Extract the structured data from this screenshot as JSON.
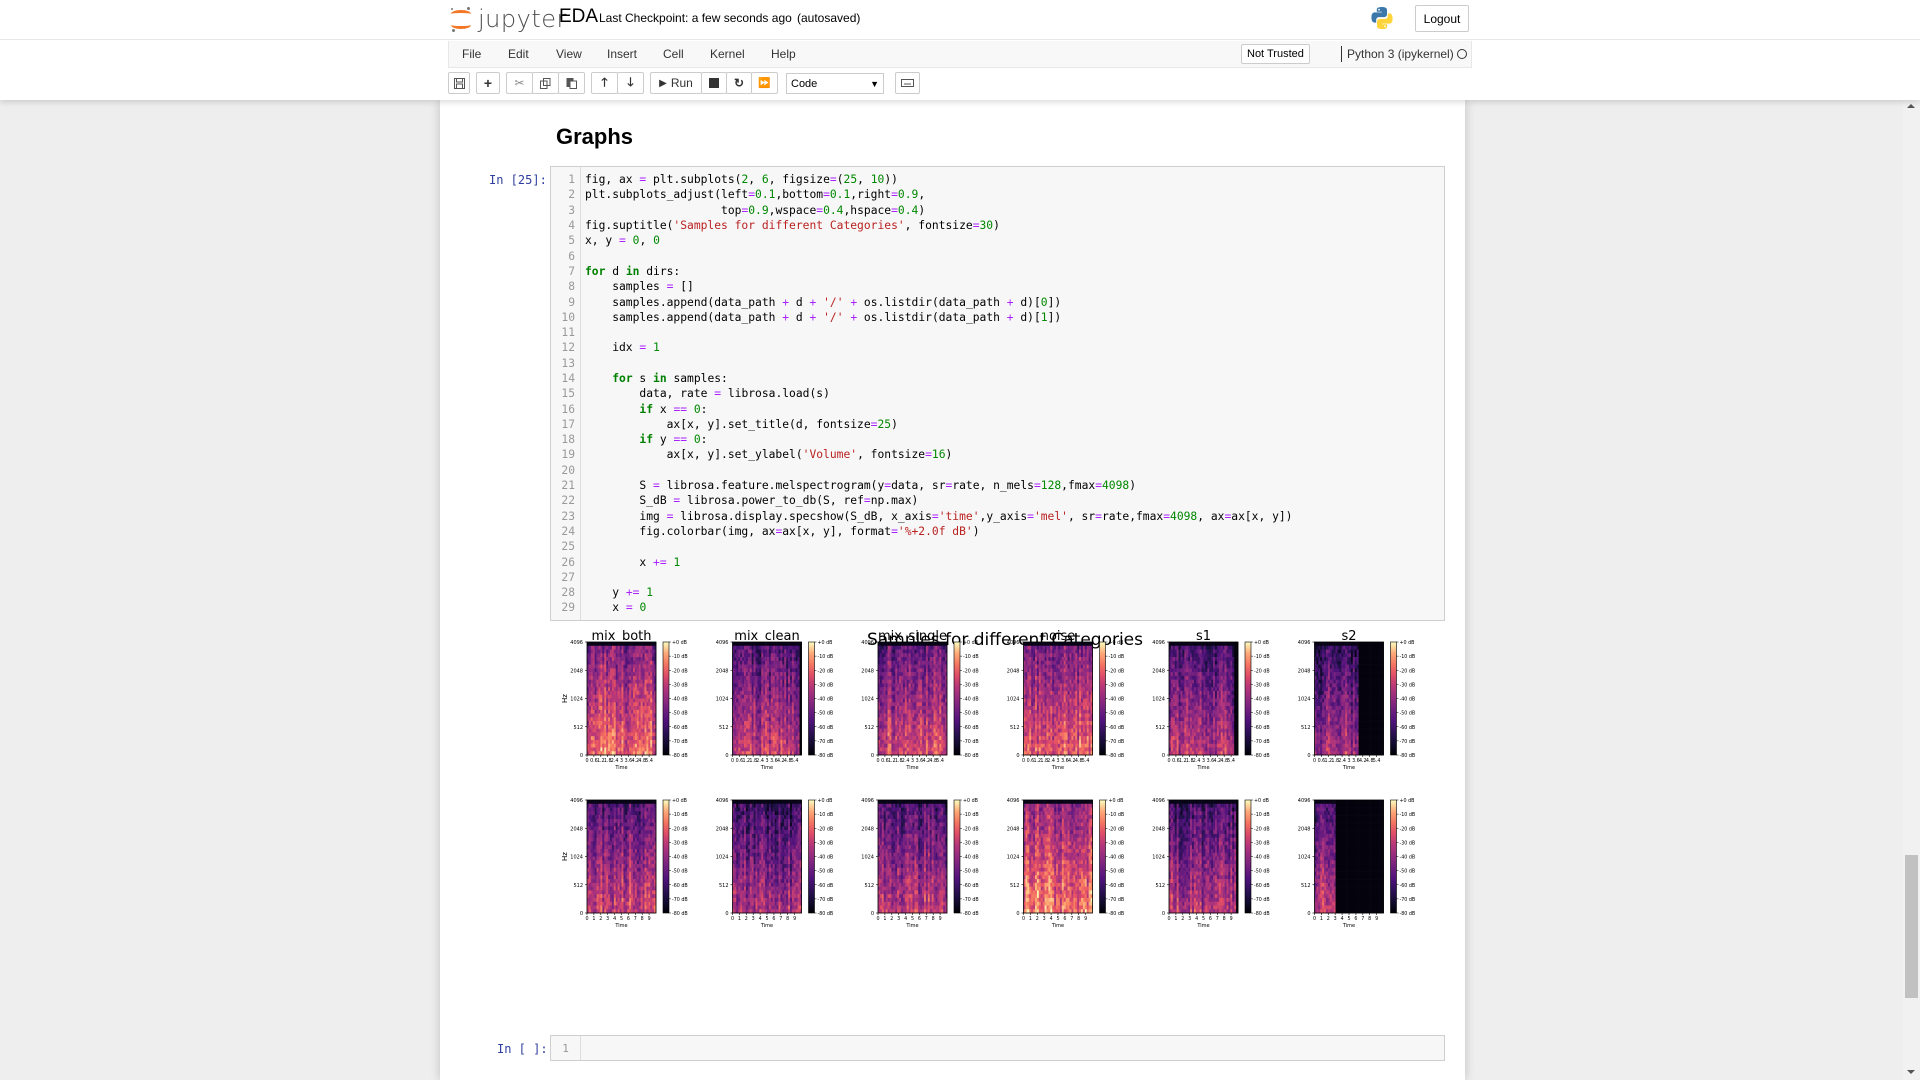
{
  "header": {
    "logo_text": "jupyter",
    "notebook_name": "EDA",
    "checkpoint": "Last Checkpoint: a few seconds ago",
    "autosave_status": "(autosaved)",
    "logout_label": "Logout"
  },
  "menubar": {
    "items": [
      "File",
      "Edit",
      "View",
      "Insert",
      "Cell",
      "Kernel",
      "Help"
    ],
    "trust_label": "Not Trusted",
    "kernel_name": "Python 3 (ipykernel)"
  },
  "toolbar": {
    "run_label": "Run",
    "cell_type": "Code",
    "buttons": [
      "save-icon",
      "insert-cell-below-icon",
      "cut-icon",
      "copy-icon",
      "paste-icon",
      "move-up-icon",
      "move-down-icon",
      "run-icon",
      "interrupt-icon",
      "restart-icon",
      "restart-run-all-icon",
      "keyboard-icon"
    ]
  },
  "notebook": {
    "heading": "Graphs",
    "cell_prompt": "In [25]:",
    "code_lines": [
      "fig, ax = plt.subplots(2, 6, figsize=(25, 10))",
      "plt.subplots_adjust(left=0.1,bottom=0.1,right=0.9,",
      "                    top=0.9,wspace=0.4,hspace=0.4)",
      "fig.suptitle('Samples for different Categories', fontsize=30)",
      "x, y = 0, 0",
      "",
      "for d in dirs:",
      "    samples = []",
      "    samples.append(data_path + d + '/' + os.listdir(data_path + d)[0])",
      "    samples.append(data_path + d + '/' + os.listdir(data_path + d)[1])",
      "",
      "    idx = 1",
      "",
      "    for s in samples:",
      "        data, rate = librosa.load(s)",
      "        if x == 0:",
      "            ax[x, y].set_title(d, fontsize=25)",
      "        if y == 0:",
      "            ax[x, y].set_ylabel('Volume', fontsize=16)",
      "",
      "        S = librosa.feature.melspectrogram(y=data, sr=rate, n_mels=128,fmax=4098)",
      "        S_dB = librosa.power_to_db(S, ref=np.max)",
      "        img = librosa.display.specshow(S_dB, x_axis='time',y_axis='mel', sr=rate,fmax=4098, ax=ax[x, y])",
      "        fig.colorbar(img, ax=ax[x, y], format='%+2.0f dB')",
      "",
      "        x += 1",
      "",
      "    y += 1",
      "    x = 0"
    ],
    "empty_cell_prompt": "In [ ]:",
    "empty_cell_line": "1"
  },
  "scrollbar": {
    "position_fraction": 0.78,
    "visible_fraction": 0.15
  },
  "chart_data": {
    "type": "heatmap",
    "title": "Samples for different Categories",
    "columns": [
      "mix_both",
      "mix_clean",
      "mix_single",
      "noise",
      "s1",
      "s2"
    ],
    "rows": 2,
    "ylabel": "Hz",
    "xlabel": "Time",
    "y_ticks": [
      "0",
      "512",
      "1024",
      "2048",
      "4096"
    ],
    "row_x_ticks": [
      [
        "0",
        "0.6",
        "1.2",
        "1.8",
        "2.4",
        "3",
        "3.6",
        "4.2",
        "4.8",
        "5.4"
      ],
      [
        "0",
        "1",
        "2",
        "3",
        "4",
        "5",
        "6",
        "7",
        "8",
        "9"
      ]
    ],
    "colorbar_ticks": [
      "+0 dB",
      "-10 dB",
      "-20 dB",
      "-30 dB",
      "-40 dB",
      "-50 dB",
      "-60 dB",
      "-70 dB",
      "-80 dB"
    ],
    "colorbar_range_db": [
      -80,
      0
    ],
    "colormap": "magma",
    "panels": [
      {
        "row": 0,
        "col": "mix_both",
        "mean_intensity": 0.62,
        "active_until_fraction": 1.0
      },
      {
        "row": 0,
        "col": "mix_clean",
        "mean_intensity": 0.48,
        "active_until_fraction": 0.95
      },
      {
        "row": 0,
        "col": "mix_single",
        "mean_intensity": 0.55,
        "active_until_fraction": 1.0
      },
      {
        "row": 0,
        "col": "noise",
        "mean_intensity": 0.6,
        "active_until_fraction": 1.0
      },
      {
        "row": 0,
        "col": "s1",
        "mean_intensity": 0.45,
        "active_until_fraction": 0.92
      },
      {
        "row": 0,
        "col": "s2",
        "mean_intensity": 0.42,
        "active_until_fraction": 0.62
      },
      {
        "row": 1,
        "col": "mix_both",
        "mean_intensity": 0.52,
        "active_until_fraction": 1.0
      },
      {
        "row": 1,
        "col": "mix_clean",
        "mean_intensity": 0.42,
        "active_until_fraction": 1.0
      },
      {
        "row": 1,
        "col": "mix_single",
        "mean_intensity": 0.48,
        "active_until_fraction": 1.0
      },
      {
        "row": 1,
        "col": "noise",
        "mean_intensity": 0.68,
        "active_until_fraction": 1.0
      },
      {
        "row": 1,
        "col": "s1",
        "mean_intensity": 0.45,
        "active_until_fraction": 0.96
      },
      {
        "row": 1,
        "col": "s2",
        "mean_intensity": 0.45,
        "active_until_fraction": 0.3
      }
    ]
  }
}
